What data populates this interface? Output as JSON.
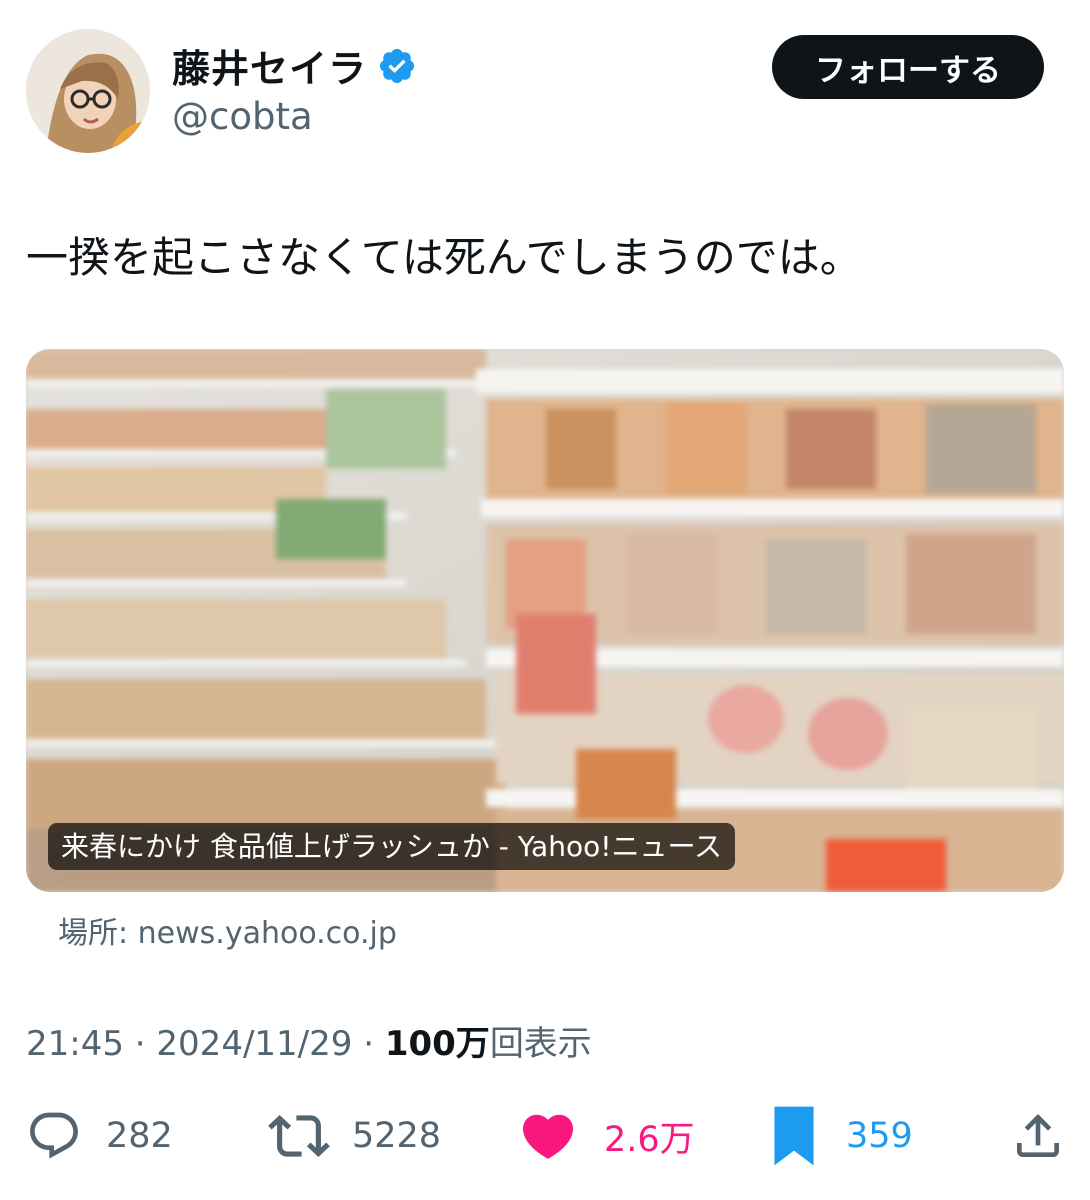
{
  "user": {
    "display_name": "藤井セイラ",
    "handle": "@cobta",
    "verified_color": "#1d9bf0"
  },
  "follow_button": {
    "label": "フォローする"
  },
  "tweet": {
    "text": "一揆を起こさなくては死んでしまうのでは。"
  },
  "card": {
    "title": "来春にかけ 食品値上げラッシュか - Yahoo!ニュース",
    "source": "場所: news.yahoo.co.jp"
  },
  "meta": {
    "time": "21:45",
    "separator": " · ",
    "date": "2024/11/29",
    "views_count": "100万",
    "views_label": "回表示"
  },
  "actions": {
    "replies": "282",
    "retweets": "5228",
    "likes": "2.6万",
    "bookmarks": "359"
  },
  "icons": {
    "reply": "speech-bubble-icon",
    "retweet": "retweet-icon",
    "like": "heart-icon",
    "bookmark": "bookmark-icon",
    "share": "share-icon"
  },
  "colors": {
    "like": "#f91880",
    "bookmark": "#1d9bf0",
    "secondary_text": "#536471"
  }
}
